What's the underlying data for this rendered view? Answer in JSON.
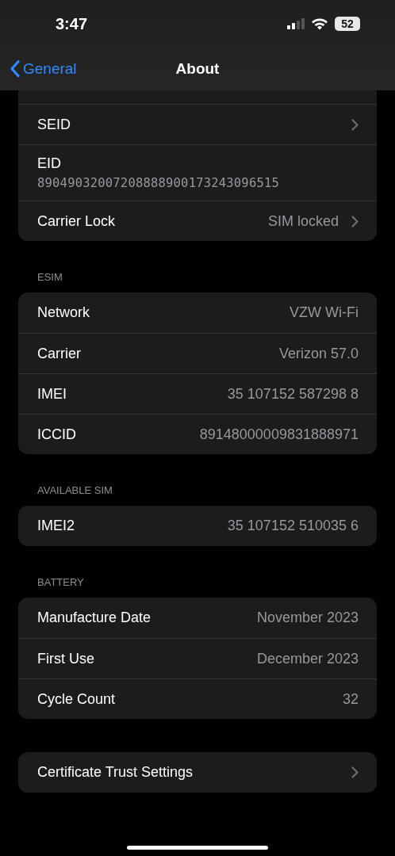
{
  "status_bar": {
    "time": "3:47",
    "battery": "52"
  },
  "nav": {
    "back": "General",
    "title": "About"
  },
  "sections": [
    {
      "rows": [
        {
          "kind": "blank"
        },
        {
          "kind": "chevron",
          "label": "SEID"
        },
        {
          "kind": "stacked",
          "label": "EID",
          "value": "89049032007208888900173243096515"
        },
        {
          "kind": "value_chevron",
          "label": "Carrier Lock",
          "value": "SIM locked"
        }
      ]
    },
    {
      "header": "ESIM",
      "rows": [
        {
          "kind": "value",
          "label": "Network",
          "value": "VZW Wi-Fi"
        },
        {
          "kind": "value",
          "label": "Carrier",
          "value": "Verizon 57.0"
        },
        {
          "kind": "value",
          "label": "IMEI",
          "value": "35 107152 587298 8"
        },
        {
          "kind": "value",
          "label": "ICCID",
          "value": "89148000009831888971"
        }
      ]
    },
    {
      "header": "AVAILABLE SIM",
      "rows": [
        {
          "kind": "value",
          "label": "IMEI2",
          "value": "35 107152 510035 6"
        }
      ]
    },
    {
      "header": "BATTERY",
      "rows": [
        {
          "kind": "value",
          "label": "Manufacture Date",
          "value": "November 2023"
        },
        {
          "kind": "value",
          "label": "First Use",
          "value": "December 2023"
        },
        {
          "kind": "value",
          "label": "Cycle Count",
          "value": "32"
        }
      ]
    },
    {
      "rows": [
        {
          "kind": "chevron",
          "label": "Certificate Trust Settings"
        }
      ]
    }
  ]
}
